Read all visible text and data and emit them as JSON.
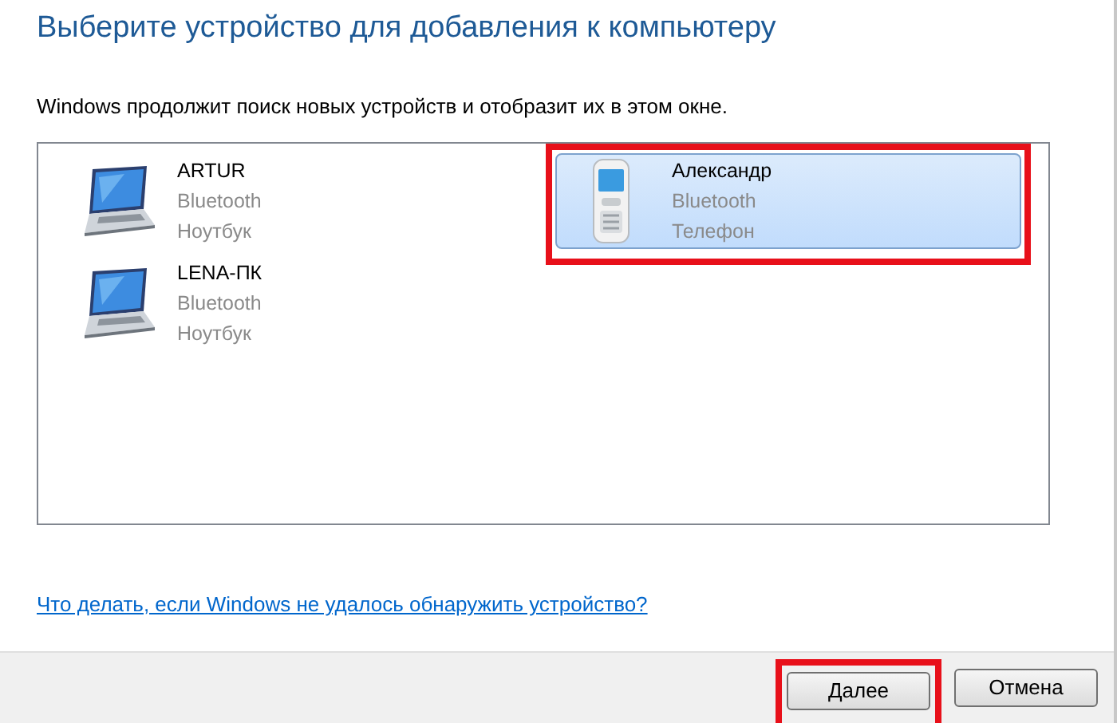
{
  "title": "Выберите устройство для добавления к компьютеру",
  "subtitle": "Windows продолжит поиск новых устройств и отобразит их в этом окне.",
  "devices": [
    {
      "name": "ARTUR",
      "connection": "Bluetooth",
      "type": "Ноутбук",
      "kind": "laptop",
      "selected": false,
      "highlighted": false
    },
    {
      "name": "Александр",
      "connection": "Bluetooth",
      "type": "Телефон",
      "kind": "phone",
      "selected": true,
      "highlighted": true
    },
    {
      "name": "LENA-ПК",
      "connection": "Bluetooth",
      "type": "Ноутбук",
      "kind": "laptop",
      "selected": false,
      "highlighted": false
    }
  ],
  "help_link": "Что делать, если Windows не удалось обнаружить устройство?",
  "buttons": [
    {
      "label": "Далее",
      "highlighted": true
    },
    {
      "label": "Отмена",
      "highlighted": false
    }
  ]
}
